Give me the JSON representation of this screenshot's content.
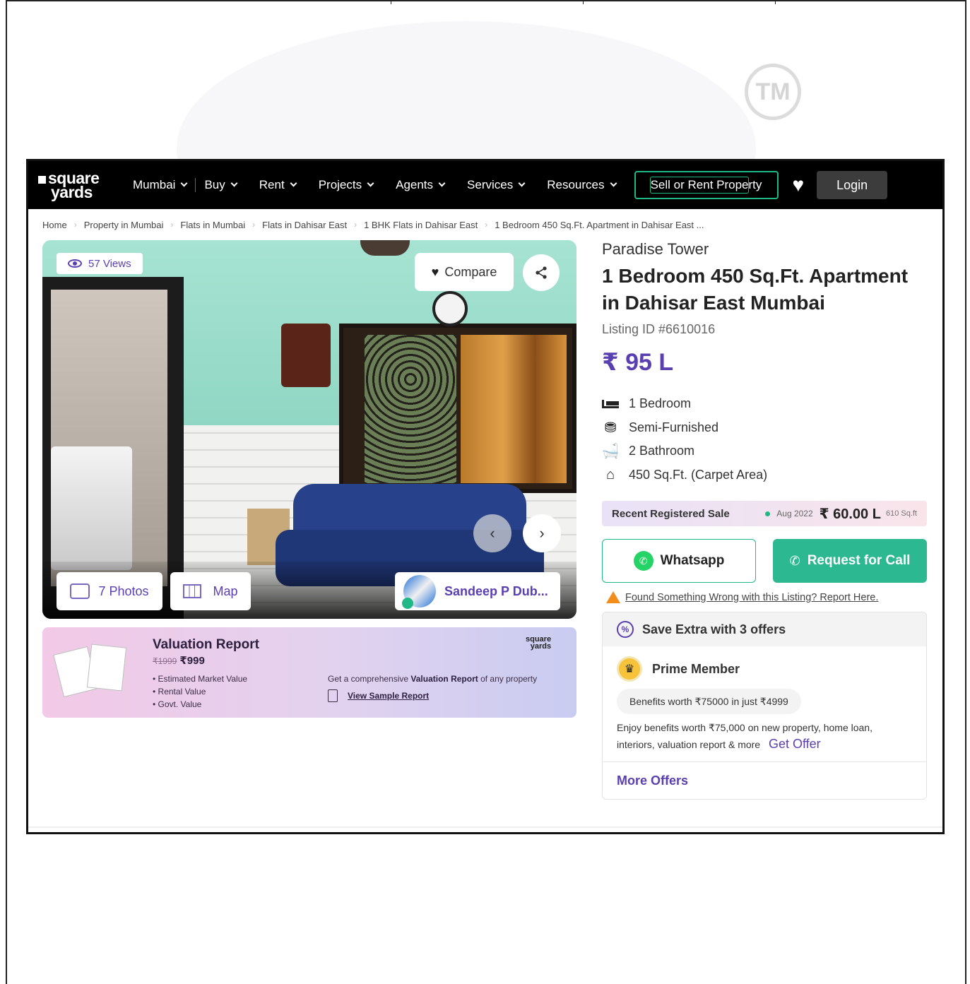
{
  "header": {
    "logo_line1": "square",
    "logo_line2": "yards",
    "nav": [
      {
        "label": "Mumbai"
      },
      {
        "label": "Buy"
      },
      {
        "label": "Rent"
      },
      {
        "label": "Projects"
      },
      {
        "label": "Agents"
      },
      {
        "label": "Services"
      },
      {
        "label": "Resources"
      }
    ],
    "sell_label": "Sell or Rent Property",
    "login_label": "Login"
  },
  "breadcrumb": [
    "Home",
    "Property in Mumbai",
    "Flats in Mumbai",
    "Flats in Dahisar East",
    "1 BHK Flats in Dahisar East",
    "1 Bedroom 450 Sq.Ft. Apartment in Dahisar East ..."
  ],
  "gallery": {
    "views": "57 Views",
    "compare_label": "Compare",
    "photos_label": "7 Photos",
    "map_label": "Map",
    "agent_name": "Sandeep P Dub..."
  },
  "valuation": {
    "title": "Valuation Report",
    "old_price": "₹1999",
    "price": "₹999",
    "items": [
      "Estimated Market Value",
      "Rental Value",
      "Govt. Value"
    ],
    "desc_prefix": "Get a comprehensive ",
    "desc_bold": "Valuation Report",
    "desc_suffix": " of any property",
    "link": "View Sample Report",
    "logo_line1": "square",
    "logo_line2": "yards"
  },
  "details": {
    "project": "Paradise Tower",
    "title": "1 Bedroom 450 Sq.Ft. Apartment in Dahisar East Mumbai",
    "listing_id": "Listing ID #6610016",
    "price": "₹ 95 L",
    "features": [
      {
        "icon": "bed-icon",
        "label": "1 Bedroom"
      },
      {
        "icon": "armchair-icon",
        "label": "Semi-Furnished"
      },
      {
        "icon": "bathtub-icon",
        "label": "2 Bathroom"
      },
      {
        "icon": "home-icon",
        "label": "450 Sq.Ft. (Carpet Area)"
      }
    ],
    "recent_sale": {
      "label": "Recent Registered Sale",
      "date": "Aug 2022",
      "amount": "₹ 60.00 L",
      "area": "610 Sq.ft"
    },
    "whatsapp_label": "Whatsapp",
    "call_label": "Request for Call",
    "report_text": "Found Something Wrong with this Listing? Report Here.",
    "offers": {
      "heading": "Save Extra with 3 offers",
      "prime_title": "Prime Member",
      "prime_chip": "Benefits worth ₹75000 in just ₹4999",
      "prime_desc": "Enjoy benefits worth ₹75,000 on new property, home loan, interiors, valuation report & more",
      "get_offer": "Get Offer",
      "more_offers": "More Offers"
    }
  },
  "colors": {
    "brand_purple": "#5a3fb0",
    "green": "#2cb991",
    "navbar": "#000000"
  }
}
